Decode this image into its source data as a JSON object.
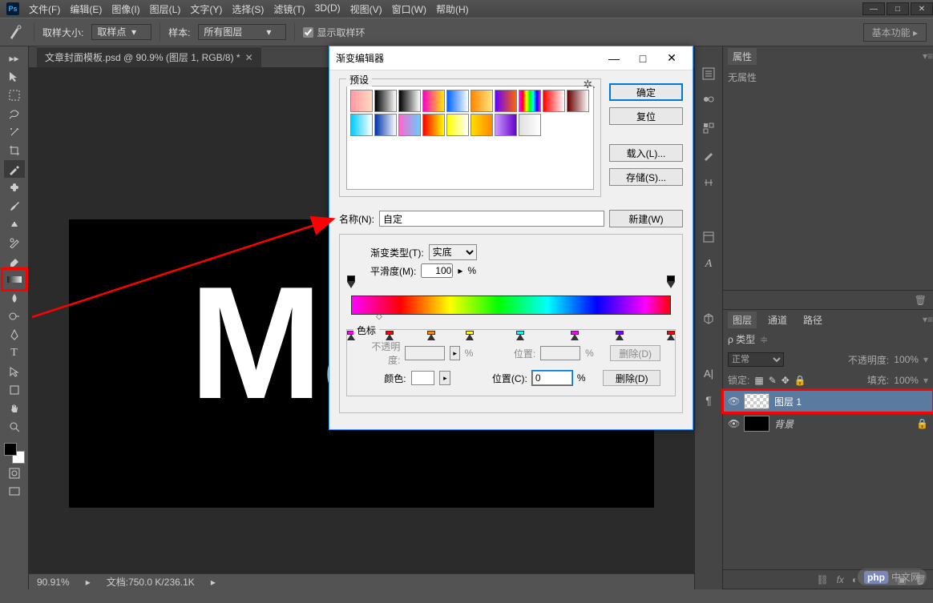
{
  "menubar": {
    "items": [
      "文件(F)",
      "编辑(E)",
      "图像(I)",
      "图层(L)",
      "文字(Y)",
      "选择(S)",
      "滤镜(T)",
      "3D(D)",
      "视图(V)",
      "窗口(W)",
      "帮助(H)"
    ]
  },
  "window_controls": {
    "min": "—",
    "max": "□",
    "close": "✕"
  },
  "optionsbar": {
    "sample_size_label": "取样大小:",
    "sample_size_value": "取样点",
    "sample_label": "样本:",
    "sample_value": "所有图层",
    "show_ring_label": "显示取样环",
    "right_button": "基本功能"
  },
  "document": {
    "tab_title": "文章封面模板.psd @ 90.9% (图层 1, RGB/8) *",
    "canvas_text": "Ma",
    "zoom": "90.91%",
    "doc_size": "文档:750.0 K/236.1K"
  },
  "panels": {
    "properties": {
      "tab": "属性",
      "body": "无属性"
    },
    "layers": {
      "tabs": [
        "图层",
        "通道",
        "路径"
      ],
      "kind_label": "ρ 类型",
      "blend_mode": "正常",
      "opacity_label": "不透明度:",
      "opacity_value": "100%",
      "lock_label": "锁定:",
      "fill_label": "填充:",
      "fill_value": "100%",
      "rows": [
        {
          "name": "图层 1",
          "selected": true,
          "highlight": true,
          "thumb": "checker",
          "locked": false
        },
        {
          "name": "背景",
          "selected": false,
          "highlight": false,
          "thumb": "black",
          "locked": true,
          "italic": true
        }
      ]
    }
  },
  "dialog": {
    "title": "渐变编辑器",
    "presets_legend": "预设",
    "buttons": {
      "ok": "确定",
      "cancel": "复位",
      "load": "载入(L)...",
      "save": "存储(S)...",
      "new": "新建(W)"
    },
    "name_label": "名称(N):",
    "name_value": "自定",
    "grad_type_label": "渐变类型(T):",
    "grad_type_value": "实底",
    "smooth_label": "平滑度(M):",
    "smooth_value": "100",
    "smooth_unit": "%",
    "color_stops_legend": "色标",
    "opacity_row": {
      "label": "不透明度:",
      "unit": "%",
      "pos_label": "位置:",
      "pos_unit": "%",
      "delete": "删除(D)"
    },
    "color_row": {
      "label": "颜色:",
      "pos_label": "位置(C):",
      "pos_value": "0",
      "pos_unit": "%",
      "delete": "删除(D)"
    },
    "preset_gradients": [
      "linear-gradient(90deg,#ff9aa2,#ffdac1)",
      "linear-gradient(90deg,#000,#fff)",
      "linear-gradient(90deg,#000,rgba(0,0,0,0))",
      "linear-gradient(90deg,#ff00c8,#ffeb00)",
      "linear-gradient(90deg,#0066ff,#fff)",
      "linear-gradient(90deg,#ff8800,#ffe680)",
      "linear-gradient(90deg,#6600ff,#ff6600)",
      "linear-gradient(90deg,#ff00ff,#ff0000,#ffff00,#00ff00,#00ffff,#0000ff,#ff00ff)",
      "linear-gradient(90deg,#ff0000,#fff)",
      "linear-gradient(90deg,#660000,#fff)",
      "linear-gradient(90deg,#00ccff,#fff)",
      "linear-gradient(90deg,#0033aa,#fff)",
      "linear-gradient(90deg,#ff66cc,#66ccff)",
      "linear-gradient(90deg,#ff0000,#ffff00)",
      "linear-gradient(90deg,#ffff00,#fff)",
      "linear-gradient(90deg,#ffdd00,#ff8800)",
      "linear-gradient(90deg,#cc99ff,#6600cc)",
      "linear-gradient(90deg,#e0e0e0,#fff)"
    ],
    "bottom_stops": [
      {
        "pos": 0,
        "color": "#ff00ff"
      },
      {
        "pos": 12,
        "color": "#ff0000"
      },
      {
        "pos": 25,
        "color": "#ff8800"
      },
      {
        "pos": 37,
        "color": "#ffff00"
      },
      {
        "pos": 53,
        "color": "#00ffff"
      },
      {
        "pos": 70,
        "color": "#ff00ff"
      },
      {
        "pos": 84,
        "color": "#8000ff"
      },
      {
        "pos": 100,
        "color": "#ff0000"
      }
    ]
  },
  "watermark": "中文网",
  "watermark_prefix": "php"
}
